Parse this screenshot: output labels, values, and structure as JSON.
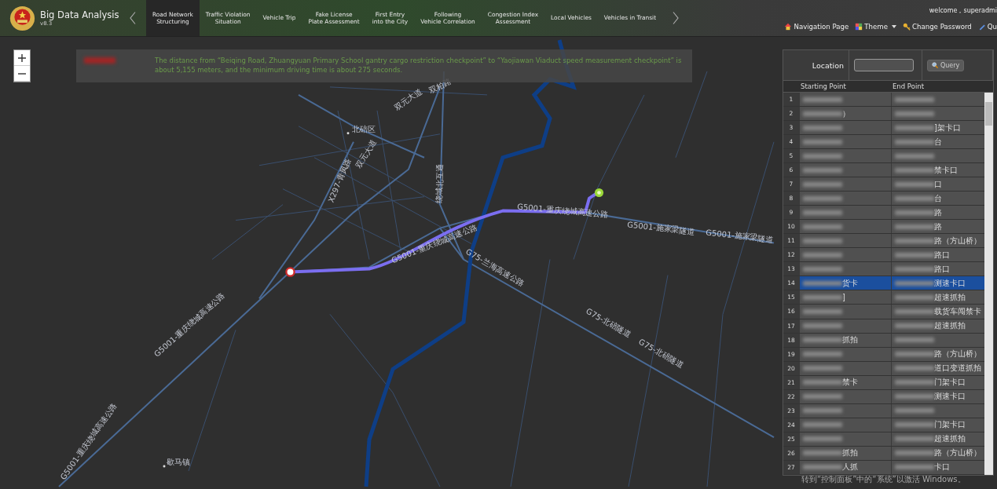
{
  "header": {
    "app_title": "Big Data Analysis",
    "version": "v8.3",
    "tabs": [
      {
        "label": "Road Network\nStructuring",
        "selected": true
      },
      {
        "label": "Traffic Violation\nSituation",
        "selected": false
      },
      {
        "label": "Vehicle Trip",
        "selected": false
      },
      {
        "label": "Fake License\nPlate Assessment",
        "selected": false
      },
      {
        "label": "First Entry\ninto the City",
        "selected": false
      },
      {
        "label": "Following\nVehicle Correlation",
        "selected": false
      },
      {
        "label": "Congestion Index\nAssessment",
        "selected": false
      },
      {
        "label": "Local Vehicles",
        "selected": false
      },
      {
        "label": "Vehicles in Transit",
        "selected": false
      }
    ],
    "welcome": "welcome，superadmi",
    "links": [
      {
        "kind": "home",
        "label": "Navigation Page"
      },
      {
        "kind": "theme",
        "label": "Theme"
      },
      {
        "kind": "key",
        "label": "Change Password"
      },
      {
        "kind": "exit",
        "label": "Qu"
      }
    ]
  },
  "info_banner": {
    "message": "The distance from “Beiqing Road, Zhuangyuan Primary School gantry cargo restriction checkpoint” to “Yaojiawan Viaduct speed measurement checkpoint” is about 5,155 meters, and the minimum driving time is about 275 seconds."
  },
  "map": {
    "labels": [
      {
        "text": "北碚区"
      },
      {
        "text": "双元大道"
      },
      {
        "text": "双柏路"
      },
      {
        "text": "双元大道"
      },
      {
        "text": "X297-青凤路"
      },
      {
        "text": "绕城北互通"
      },
      {
        "text": "G5001-重庆绕城高速公路"
      },
      {
        "text": "G5001-重庆绕城高速公路"
      },
      {
        "text": "G5001-施家梁隧道"
      },
      {
        "text": "G5001-施家梁隧道"
      },
      {
        "text": "G75-兰海高速公路"
      },
      {
        "text": "G75-北碚隧道"
      },
      {
        "text": "G75-北碚隧道"
      },
      {
        "text": "G5001-重庆绕城高速公路"
      },
      {
        "text": "G5001-重庆绕城高速公路"
      },
      {
        "text": "歇马镇"
      }
    ]
  },
  "query_panel": {
    "location_label": "Location",
    "query_button": "Query",
    "columns": [
      "Starting Point",
      "End Point"
    ],
    "rows": [
      {
        "num": "1",
        "selected": false
      },
      {
        "num": "2",
        "start": "）",
        "selected": false
      },
      {
        "num": "3",
        "end": "]架卡口",
        "selected": false
      },
      {
        "num": "4",
        "end": "台",
        "selected": false
      },
      {
        "num": "5",
        "selected": false
      },
      {
        "num": "6",
        "end": "禁卡口",
        "selected": false
      },
      {
        "num": "7",
        "end": "口",
        "selected": false
      },
      {
        "num": "8",
        "end": "台",
        "selected": false
      },
      {
        "num": "9",
        "end": "路",
        "selected": false
      },
      {
        "num": "10",
        "end": "路",
        "selected": false
      },
      {
        "num": "11",
        "end": "路（方山桥）",
        "selected": false
      },
      {
        "num": "12",
        "end": "路口",
        "selected": false
      },
      {
        "num": "13",
        "end": "路口",
        "selected": false
      },
      {
        "num": "14",
        "start": "货卡",
        "end": "测速卡口",
        "selected": true
      },
      {
        "num": "15",
        "start": "]",
        "end": "超速抓拍",
        "selected": false
      },
      {
        "num": "16",
        "end": "载货车闯禁卡",
        "selected": false
      },
      {
        "num": "17",
        "end": "超速抓拍",
        "selected": false
      },
      {
        "num": "18",
        "start": "抓拍",
        "selected": false
      },
      {
        "num": "19",
        "end": "路（方山桥）",
        "selected": false
      },
      {
        "num": "20",
        "end": "道口变道抓拍",
        "selected": false
      },
      {
        "num": "21",
        "start": "禁卡",
        "end": "门架卡口",
        "selected": false
      },
      {
        "num": "22",
        "end": "测速卡口",
        "selected": false
      },
      {
        "num": "23",
        "selected": false
      },
      {
        "num": "24",
        "end": "门架卡口",
        "selected": false
      },
      {
        "num": "25",
        "end": "超速抓拍",
        "selected": false
      },
      {
        "num": "26",
        "start": "抓拍",
        "end": "路（方山桥）",
        "selected": false
      },
      {
        "num": "27",
        "start": "人抓",
        "end": "卡口",
        "selected": false
      }
    ]
  },
  "os_notice": "转到“控制面板”中的“系统”以激活 Windows。"
}
